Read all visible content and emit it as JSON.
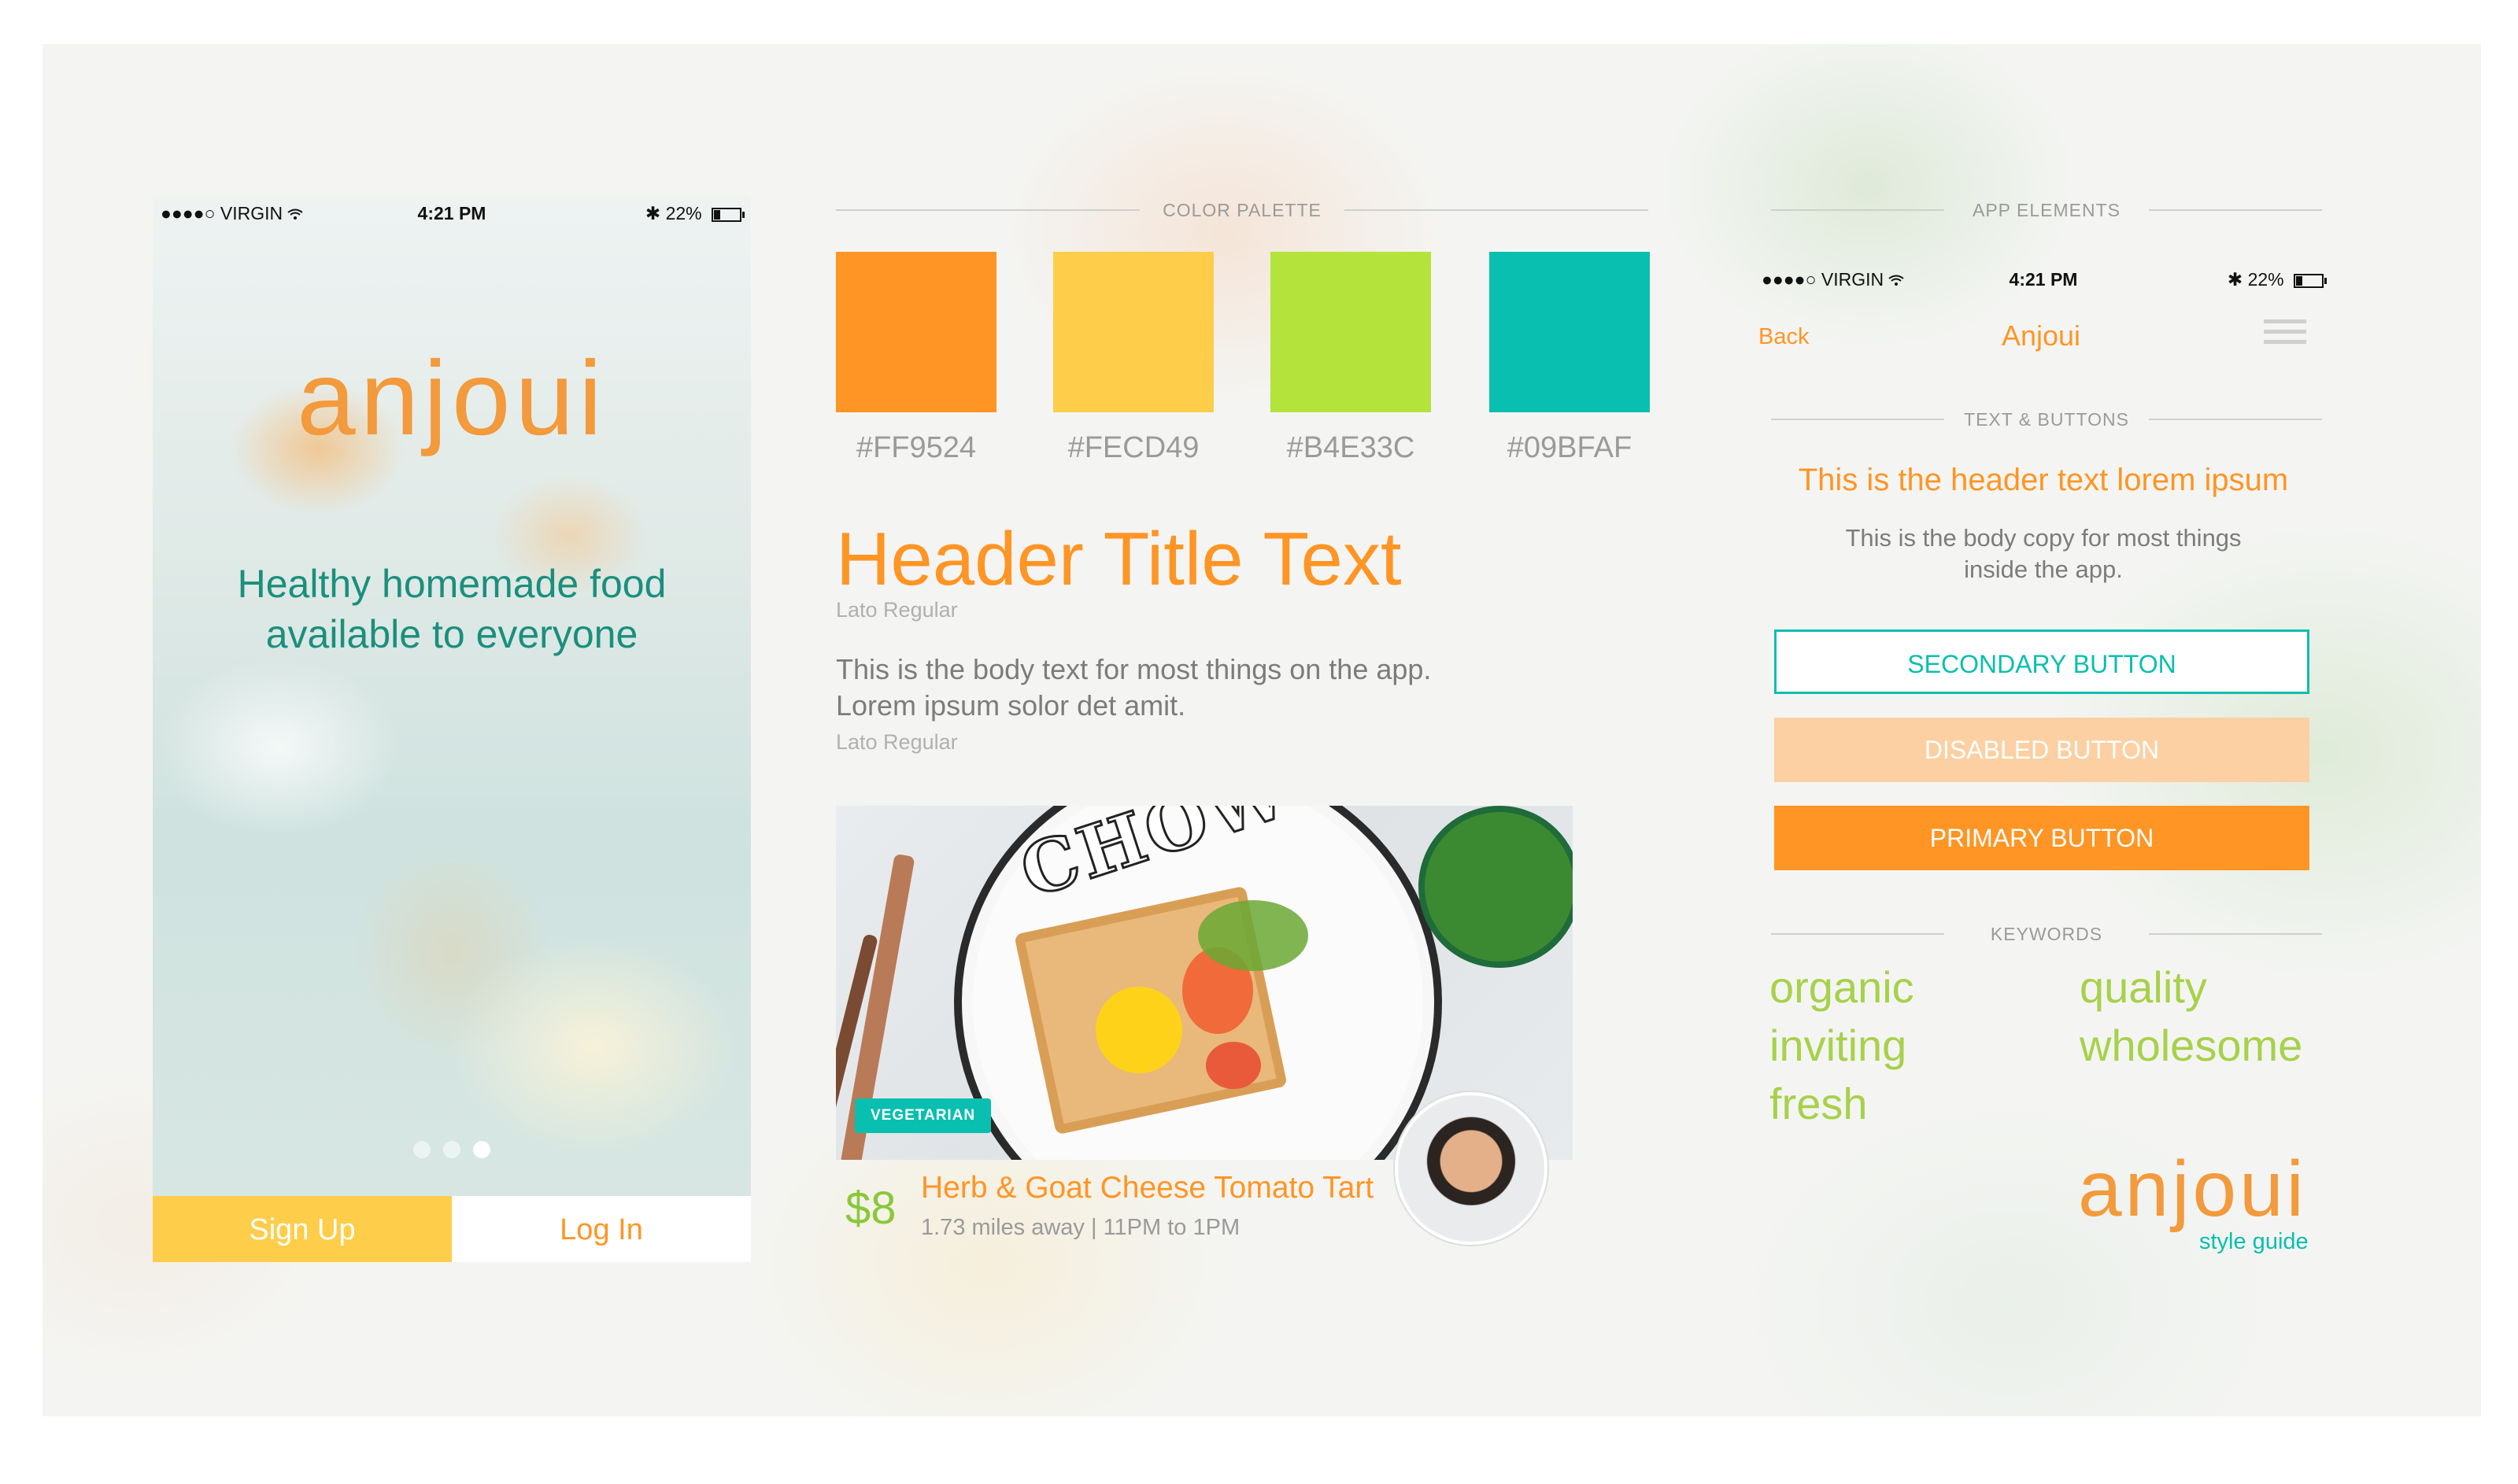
{
  "colors": {
    "orange": "#FF9524",
    "yellow": "#FECD49",
    "green": "#B4E33C",
    "teal": "#09BFAF"
  },
  "phone": {
    "status": {
      "carrier": "●●●●○ VIRGIN",
      "wifi_icon": "wifi-icon",
      "time": "4:21 PM",
      "bluetooth": "✱",
      "battery": "22%"
    },
    "logo": "anjoui",
    "tagline_line1": "Healthy homemade food",
    "tagline_line2": "available to everyone",
    "carousel_pages": 3,
    "carousel_active": 3,
    "signup_label": "Sign Up",
    "login_label": "Log In"
  },
  "palette": {
    "section_title": "COLOR PALETTE",
    "swatches": [
      {
        "hex": "#FF9524",
        "label": "#FF9524"
      },
      {
        "hex": "#FECD49",
        "label": "#FECD49"
      },
      {
        "hex": "#B4E33C",
        "label": "#B4E33C"
      },
      {
        "hex": "#09BFAF",
        "label": "#09BFAF"
      }
    ]
  },
  "typography": {
    "header_title": "Header Title Text",
    "header_font_note": "Lato Regular",
    "body_line1": "This is the body text for most things on the app.",
    "body_line2": "Lorem ipsum solor det amit.",
    "body_font_note": "Lato Regular"
  },
  "food_card": {
    "plate_text": "CHOW",
    "tag": "VEGETARIAN",
    "price": "$8",
    "name": "Herb & Goat Cheese Tomato Tart",
    "meta": "1.73 miles away | 11PM to 1PM"
  },
  "app_elements": {
    "section_title": "APP ELEMENTS",
    "status": {
      "carrier": "●●●●○ VIRGIN",
      "time": "4:21 PM",
      "bluetooth": "✱",
      "battery": "22%"
    },
    "nav_back": "Back",
    "nav_title": "Anjoui",
    "text_buttons_title": "TEXT & BUTTONS",
    "header_text": "This is the header text lorem ipsum",
    "body_line1": "This is the body copy for most things",
    "body_line2": "inside the app.",
    "secondary_button": "SECONDARY BUTTON",
    "disabled_button": "DISABLED BUTTON",
    "primary_button": "PRIMARY BUTTON",
    "keywords_title": "KEYWORDS",
    "keywords": [
      "organic",
      "quality",
      "inviting",
      "wholesome",
      "fresh"
    ],
    "logo": "anjoui",
    "logo_sub": "style guide"
  }
}
